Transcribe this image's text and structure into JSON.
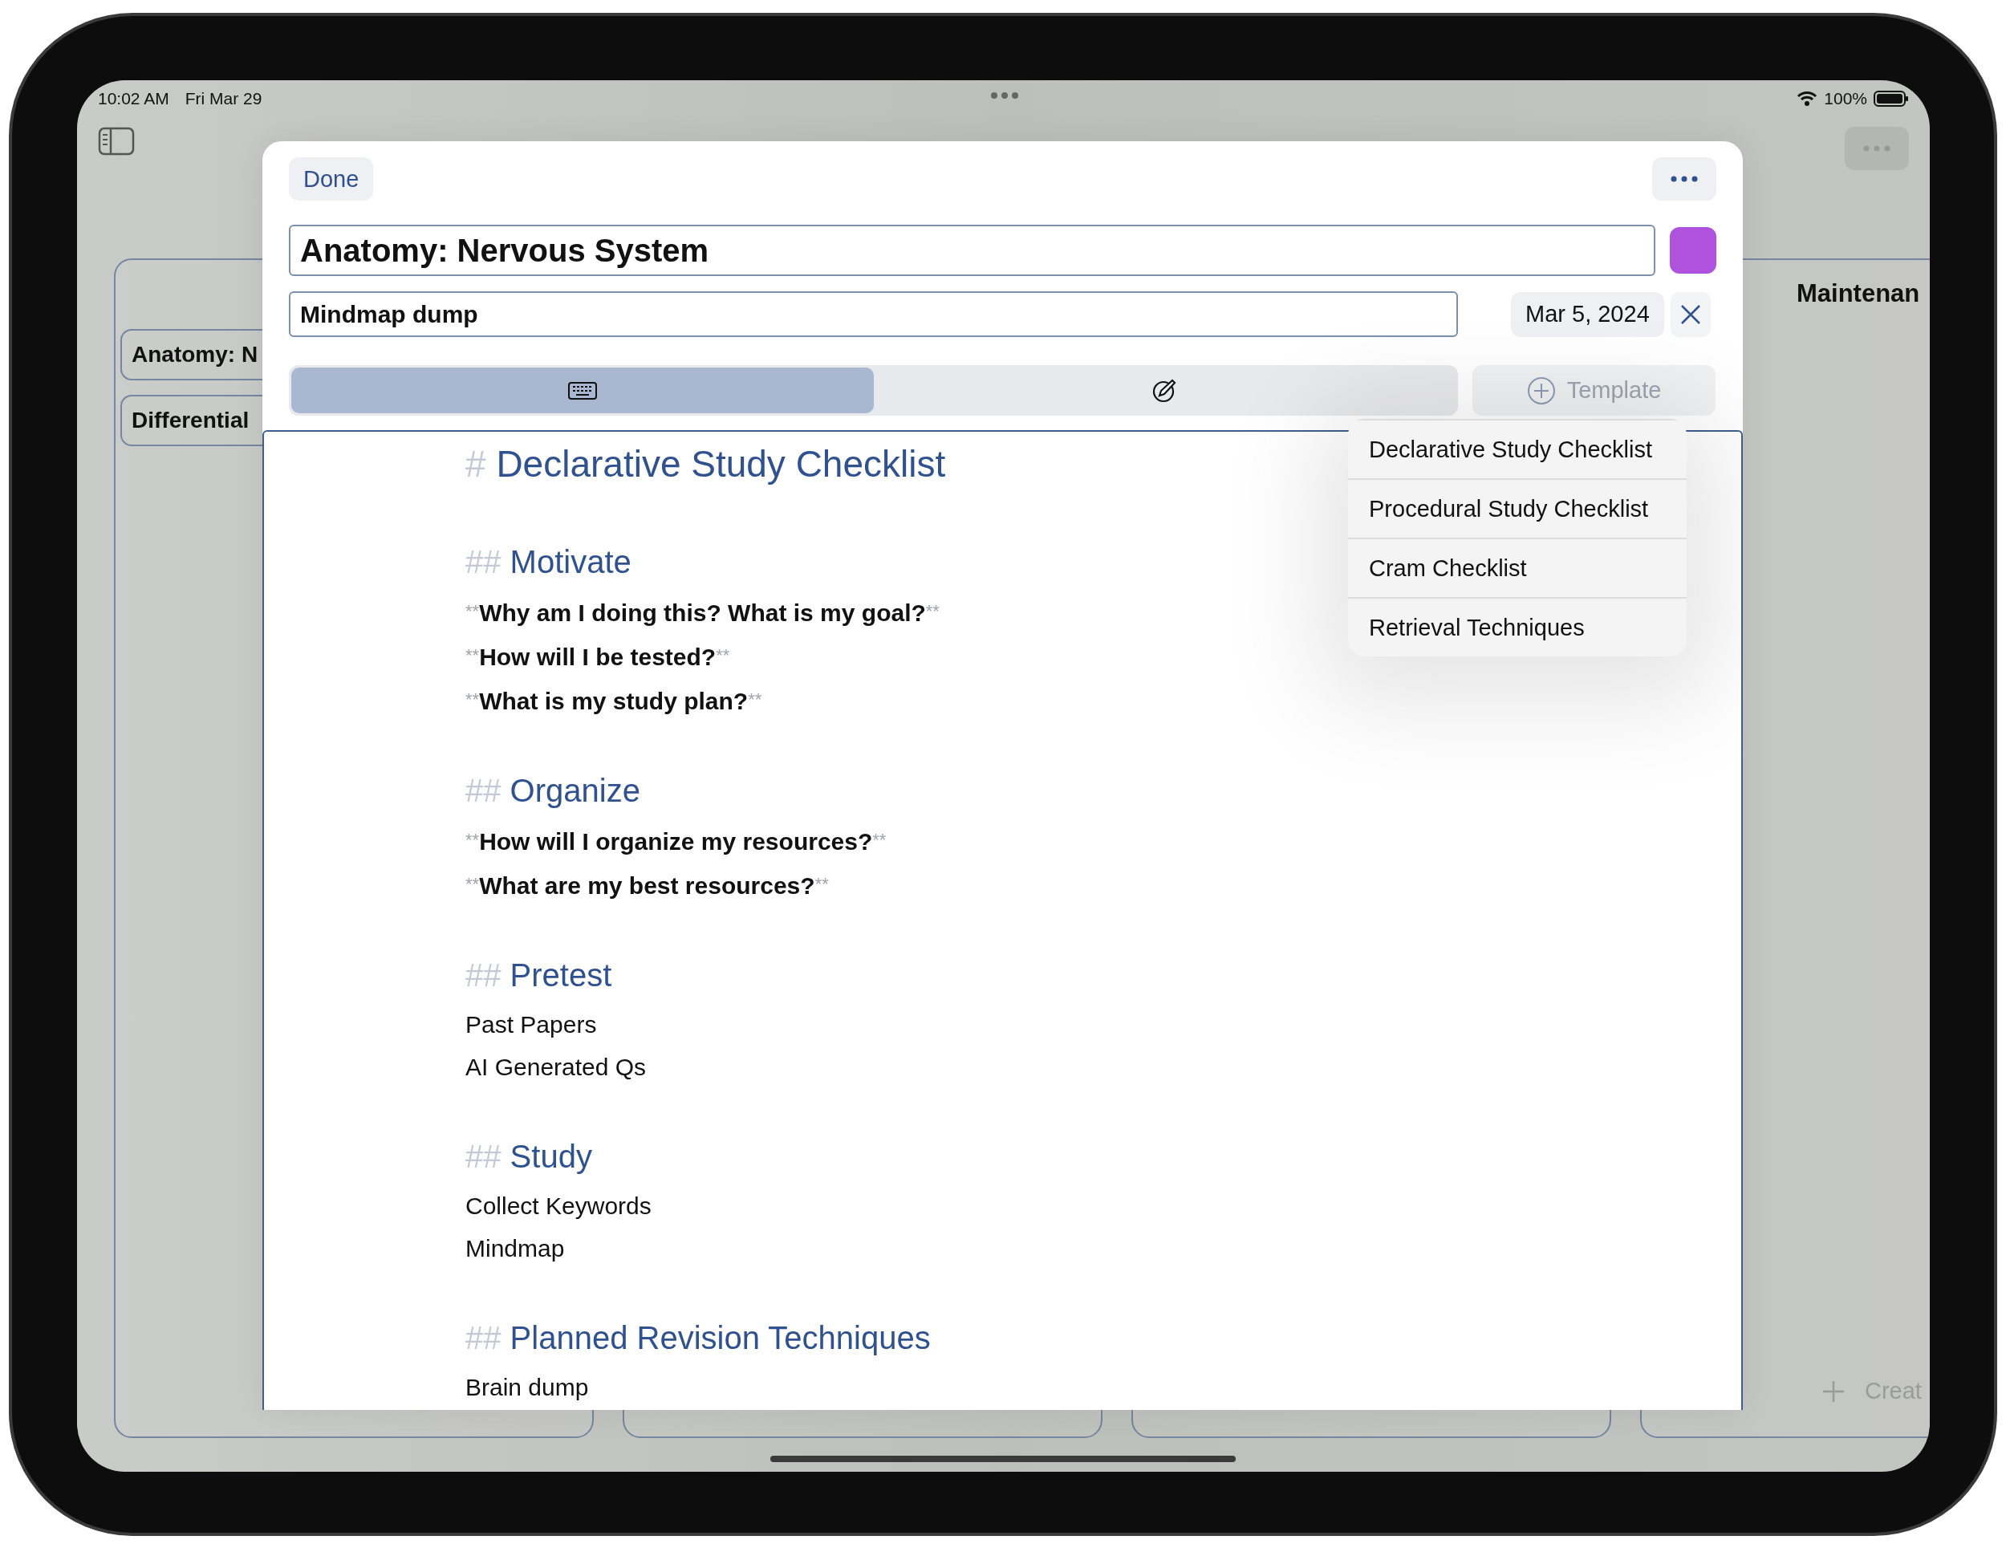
{
  "status_bar": {
    "time": "10:02 AM",
    "date": "Fri Mar 29",
    "battery": "100%"
  },
  "background": {
    "cards": [
      "Anatomy: N",
      "Differential"
    ],
    "column_title": "Maintenan",
    "create_button": "Creat"
  },
  "sheet": {
    "done": "Done",
    "title": "Anatomy: Nervous System",
    "color": "#af52de",
    "subtitle": "Mindmap dump",
    "date": "Mar 5, 2024",
    "modes": [
      {
        "kind": "keyboard",
        "selected": true
      },
      {
        "kind": "pencil",
        "selected": false
      }
    ],
    "template_button": {
      "label": "Template",
      "disabled": true
    },
    "template_menu": [
      "Declarative Study Checklist",
      "Procedural Study Checklist",
      "Cram Checklist",
      "Retrieval Techniques"
    ],
    "lines": [
      {
        "kind": "h1",
        "marker": "#",
        "text": "Declarative Study Checklist"
      },
      {
        "kind": "h2",
        "marker": "##",
        "text": "Motivate"
      },
      {
        "kind": "bold",
        "open": "**",
        "text": "Why am I doing this? What is my goal?",
        "close": "**"
      },
      {
        "kind": "bold",
        "open": "**",
        "text": "How will I be tested?",
        "close": "**"
      },
      {
        "kind": "bold",
        "open": "**",
        "text": "What is my study plan?",
        "close": "**"
      },
      {
        "kind": "h2",
        "marker": "##",
        "text": "Organize"
      },
      {
        "kind": "bold",
        "open": "**",
        "text": "How will I organize my resources?",
        "close": "**"
      },
      {
        "kind": "bold",
        "open": "**",
        "text": "What are my best resources?",
        "close": "**"
      },
      {
        "kind": "h2",
        "marker": "##",
        "text": "Pretest"
      },
      {
        "kind": "text",
        "text": "Past Papers"
      },
      {
        "kind": "text",
        "text": "AI Generated Qs"
      },
      {
        "kind": "h2",
        "marker": "##",
        "text": "Study"
      },
      {
        "kind": "text",
        "text": "Collect Keywords"
      },
      {
        "kind": "text",
        "text": "Mindmap"
      },
      {
        "kind": "h2",
        "marker": "##",
        "text": "Planned Revision Techniques"
      },
      {
        "kind": "text",
        "text": "Brain dump"
      }
    ]
  }
}
